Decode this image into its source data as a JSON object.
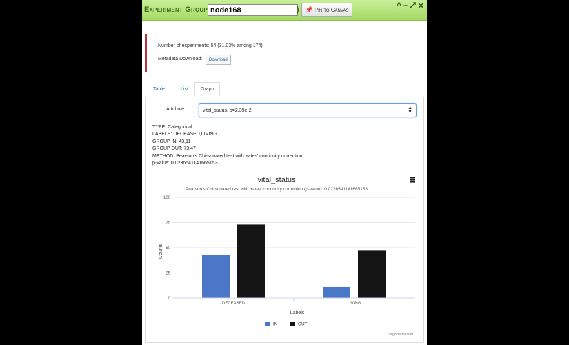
{
  "window": {
    "title_prefix": "Experiment Group (",
    "node_value": "node168",
    "title_suffix": ")",
    "pin_label": "Pin to Canvas",
    "controls": {
      "collapse": "^",
      "minimize": "–",
      "maximize": "⤢",
      "close": "✕"
    }
  },
  "info": {
    "experiments_text": "Number of experiments: 54 (31.03% among 174)",
    "metadata_label": "Metadata Download:",
    "download_label": "Download"
  },
  "tabs": [
    {
      "label": "Table"
    },
    {
      "label": "List"
    },
    {
      "label": "Graph"
    }
  ],
  "attribute": {
    "label": "Attribute",
    "selected": "vital_status, p=2.39e-2"
  },
  "stats": {
    "type": "TYPE: Categorical",
    "labels": "LABELS: DECEASED,LIVING",
    "group_in": "GROUP IN: 43,11",
    "group_out": "GROUP OUT: 73,47",
    "method": "METHOD: Pearson's Chi-squared test with Yates' continuity correction",
    "pvalue": "p-value: 0.0236541141665153"
  },
  "chart_data": {
    "type": "bar",
    "title": "vital_status",
    "subtitle": "Pearson's Chi-squared test with Yates' continuity correction (p-value): 0.0236541141665153",
    "categories": [
      "DECEASED",
      "LIVING"
    ],
    "series": [
      {
        "name": "IN",
        "values": [
          43,
          11
        ],
        "color": "#4a77c8"
      },
      {
        "name": "OUT",
        "values": [
          73,
          47
        ],
        "color": "#141414"
      }
    ],
    "xlabel": "Labels",
    "ylabel": "Counts",
    "ylim": [
      0,
      100
    ],
    "yticks": [
      0,
      25,
      50,
      75,
      100
    ],
    "grid": true,
    "legend_position": "bottom-center",
    "credits": "Highcharts.com",
    "menu_icon": "hamburger-icon"
  },
  "colors": {
    "titlebar": "#a4da63",
    "accent_border": "#b2343a",
    "link": "#2a6db5"
  }
}
